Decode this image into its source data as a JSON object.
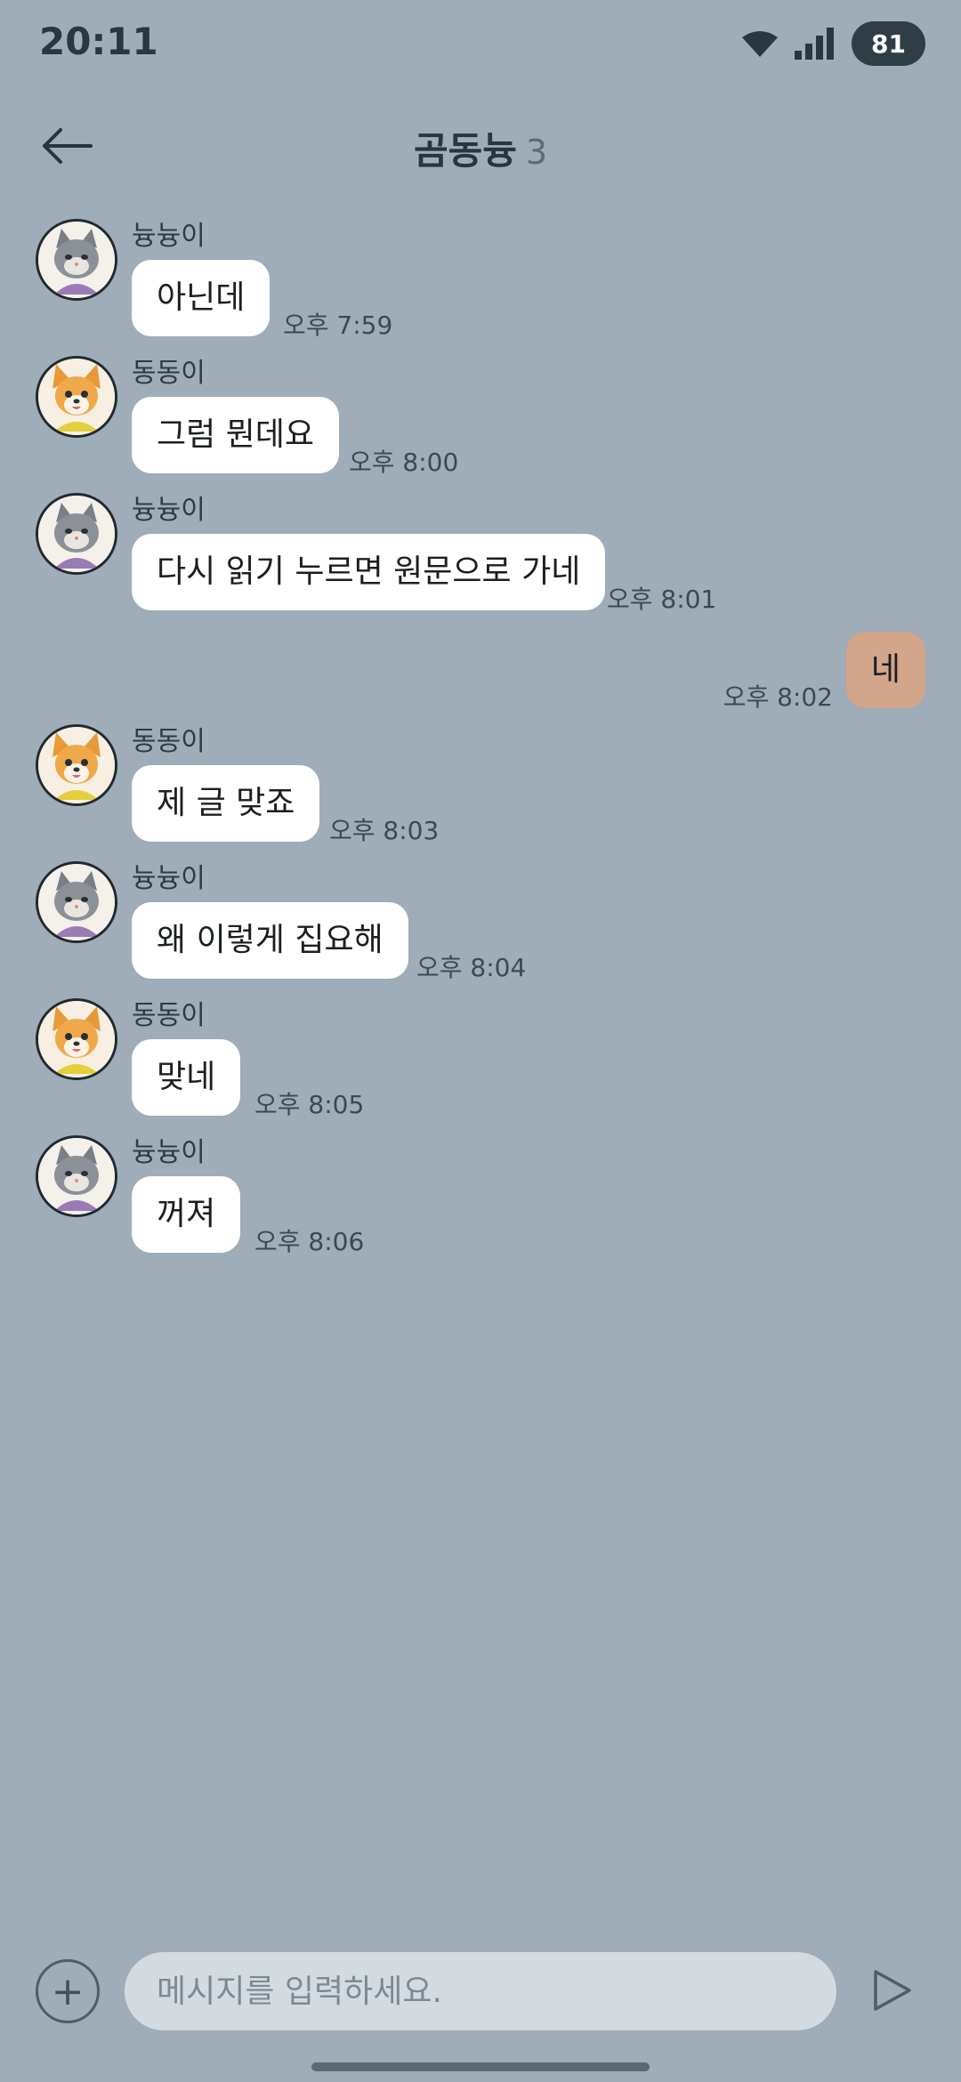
{
  "status_bar": {
    "time": "20:11",
    "battery": "81"
  },
  "header": {
    "back_icon": "back-arrow-icon",
    "title": "곰동늉",
    "member_count": "3"
  },
  "messages": [
    {
      "sender": "늉늉이",
      "avatar": "cat-avatar",
      "text": "아닌데",
      "time": "오후 7:59",
      "mine": false
    },
    {
      "sender": "동동이",
      "avatar": "dog-avatar",
      "text": "그럼 뭔데요",
      "time": "오후 8:00",
      "mine": false
    },
    {
      "sender": "늉늉이",
      "avatar": "cat-avatar",
      "text": "다시 읽기 누르면 원문으로 가네",
      "time": "오후 8:01",
      "mine": false
    },
    {
      "sender": "",
      "avatar": "",
      "text": "네",
      "time": "오후 8:02",
      "mine": true
    },
    {
      "sender": "동동이",
      "avatar": "dog-avatar",
      "text": "제 글 맞죠",
      "time": "오후 8:03",
      "mine": false
    },
    {
      "sender": "늉늉이",
      "avatar": "cat-avatar",
      "text": "왜 이렇게 집요해",
      "time": "오후 8:04",
      "mine": false
    },
    {
      "sender": "동동이",
      "avatar": "dog-avatar",
      "text": "맞네",
      "time": "오후 8:05",
      "mine": false
    },
    {
      "sender": "늉늉이",
      "avatar": "cat-avatar",
      "text": "꺼져",
      "time": "오후 8:06",
      "mine": false
    }
  ],
  "input_bar": {
    "plus_label": "+",
    "placeholder": "메시지를 입력하세요.",
    "send_icon": "send-icon"
  },
  "colors": {
    "background": "#9eadb7",
    "my_bubble": "#d3a58a",
    "other_bubble": "#ffffff",
    "input_field": "#d3dbe1"
  }
}
